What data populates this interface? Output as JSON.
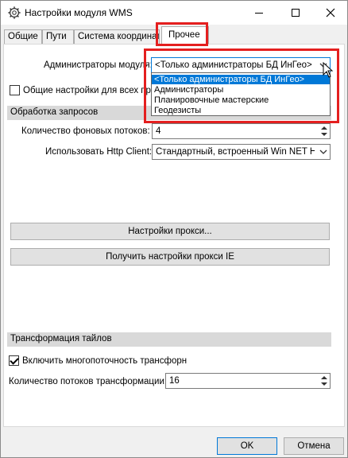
{
  "window": {
    "title": "Настройки модуля WMS"
  },
  "icons": {
    "app": "gear-icon",
    "minimize": "minimize-icon",
    "maximize": "maximize-icon",
    "close": "close-icon",
    "dropdown": "chevron-down-icon",
    "cursor": "mouse-pointer-icon"
  },
  "tabs": [
    {
      "label": "Общие"
    },
    {
      "label": "Пути"
    },
    {
      "label": "Система координат"
    },
    {
      "label": "Прочее",
      "active": true
    }
  ],
  "admins": {
    "label": "Администраторы модуля:",
    "selected": "<Только администраторы БД ИнГео>",
    "options": [
      "<Только администраторы БД ИнГео>",
      "Администраторы",
      "Планировочные мастерские",
      "Геодезисты"
    ]
  },
  "common_settings": {
    "label": "Общие настройки для всех пр",
    "checked": false
  },
  "requests_section": {
    "title": "Обработка запросов",
    "threads_label": "Количество фоновых потоков:",
    "threads_value": "4",
    "http_label": "Использовать Http Client:",
    "http_value": "Стандартный, встроенный Win NET Http",
    "proxy_button": "Настройки прокси...",
    "proxy_ie_button": "Получить настройки прокси IE"
  },
  "tiles_section": {
    "title": "Трансформация тайлов",
    "multithread_label": "Включить многопоточность трансфорн",
    "multithread_checked": true,
    "threads_label": "Количество потоков трансформации:",
    "threads_value": "16"
  },
  "footer": {
    "ok": "OK",
    "cancel": "Отмена"
  },
  "colors": {
    "highlight": "#e41f1f",
    "selection": "#0078d7"
  }
}
